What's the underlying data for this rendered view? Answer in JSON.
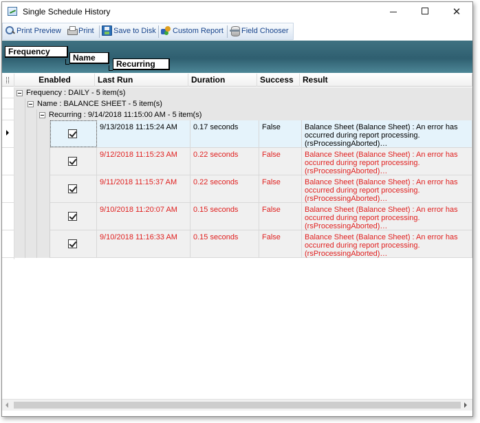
{
  "window": {
    "title": "Single Schedule History"
  },
  "toolbar": {
    "print_preview": "Print Preview",
    "print": "Print",
    "save_to_disk": "Save to Disk",
    "custom_report": "Custom Report",
    "field_chooser": "Field Chooser"
  },
  "group_panel": {
    "chips": [
      "Frequency",
      "Name",
      "Recurring"
    ]
  },
  "grid": {
    "columns": [
      "Enabled",
      "Last Run",
      "Duration",
      "Success",
      "Result"
    ],
    "groups": {
      "frequency": "Frequency : DAILY - 5 item(s)",
      "name": "Name : BALANCE SHEET - 5 item(s)",
      "recurring": "Recurring : 9/14/2018 11:15:00 AM - 5 item(s)"
    },
    "rows": [
      {
        "enabled": true,
        "last_run": "9/13/2018 11:15:24 AM",
        "duration": "0.17 seconds",
        "success": "False",
        "result": "Balance Sheet (Balance Sheet) : An error has occurred during report processing. (rsProcessingAborted)…"
      },
      {
        "enabled": true,
        "last_run": "9/12/2018 11:15:23 AM",
        "duration": "0.22 seconds",
        "success": "False",
        "result": "Balance Sheet (Balance Sheet) : An error has occurred during report processing. (rsProcessingAborted)…"
      },
      {
        "enabled": true,
        "last_run": "9/11/2018 11:15:37 AM",
        "duration": "0.22 seconds",
        "success": "False",
        "result": "Balance Sheet (Balance Sheet) : An error has occurred during report processing. (rsProcessingAborted)…"
      },
      {
        "enabled": true,
        "last_run": "9/10/2018 11:20:07 AM",
        "duration": "0.15 seconds",
        "success": "False",
        "result": "Balance Sheet (Balance Sheet) : An error has occurred during report processing. (rsProcessingAborted)…"
      },
      {
        "enabled": true,
        "last_run": "9/10/2018 11:16:33 AM",
        "duration": "0.15 seconds",
        "success": "False",
        "result": "Balance Sheet (Balance Sheet) : An error has occurred during report processing. (rsProcessingAborted)…"
      }
    ]
  },
  "colors": {
    "error_text": "#e0201f",
    "group_panel": "#3f7181",
    "selected_row": "#e5f3fb"
  }
}
